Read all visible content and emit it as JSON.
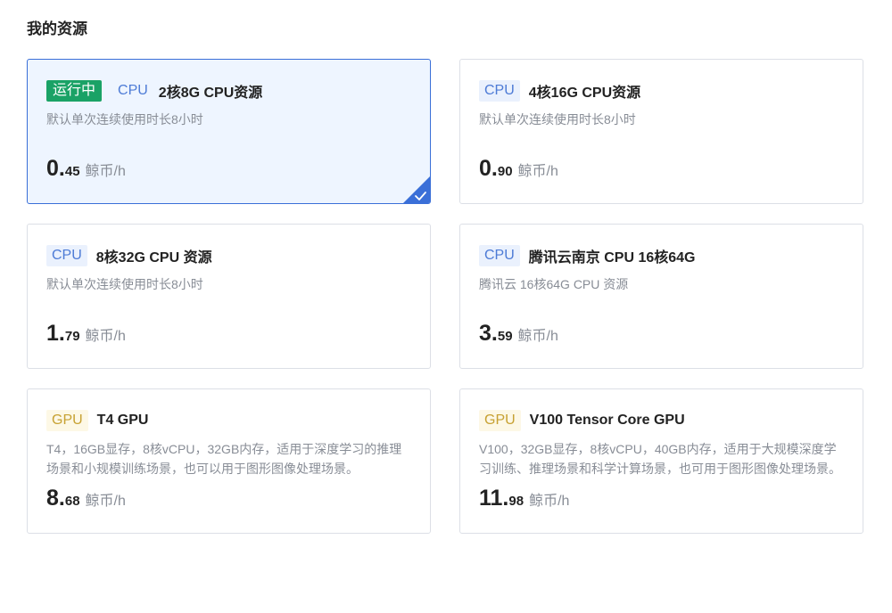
{
  "section_title": "我的资源",
  "selected_index": 0,
  "colors": {
    "running_tag": "#1aa266",
    "cpu_tag": "#4d7bd6",
    "gpu_tag": "#c7a132",
    "selected_border": "#3a6fd8",
    "selected_bg": "#eef5ff"
  },
  "cards": [
    {
      "status": "运行中",
      "type": "CPU",
      "title": "2核8G CPU资源",
      "desc": "默认单次连续使用时长8小时",
      "price_int": "0.",
      "price_dec": "45",
      "unit": "鲸币/h",
      "selected": true,
      "check_icon": "check-icon"
    },
    {
      "type": "CPU",
      "title": "4核16G CPU资源",
      "desc": "默认单次连续使用时长8小时",
      "price_int": "0.",
      "price_dec": "90",
      "unit": "鲸币/h"
    },
    {
      "type": "CPU",
      "title": "8核32G CPU 资源",
      "desc": "默认单次连续使用时长8小时",
      "price_int": "1.",
      "price_dec": "79",
      "unit": "鲸币/h"
    },
    {
      "type": "CPU",
      "title": "腾讯云南京 CPU 16核64G",
      "desc": "腾讯云 16核64G CPU 资源",
      "price_int": "3.",
      "price_dec": "59",
      "unit": "鲸币/h"
    },
    {
      "type": "GPU",
      "title": "T4 GPU",
      "desc": "T4，16GB显存，8核vCPU，32GB内存，适用于深度学习的推理场景和小规模训练场景，也可以用于图形图像处理场景。",
      "price_int": "8.",
      "price_dec": "68",
      "unit": "鲸币/h"
    },
    {
      "type": "GPU",
      "title": "V100 Tensor Core GPU",
      "desc": "V100，32GB显存，8核vCPU，40GB内存，适用于大规模深度学习训练、推理场景和科学计算场景，也可用于图形图像处理场景。",
      "price_int": "11.",
      "price_dec": "98",
      "unit": "鲸币/h"
    }
  ]
}
